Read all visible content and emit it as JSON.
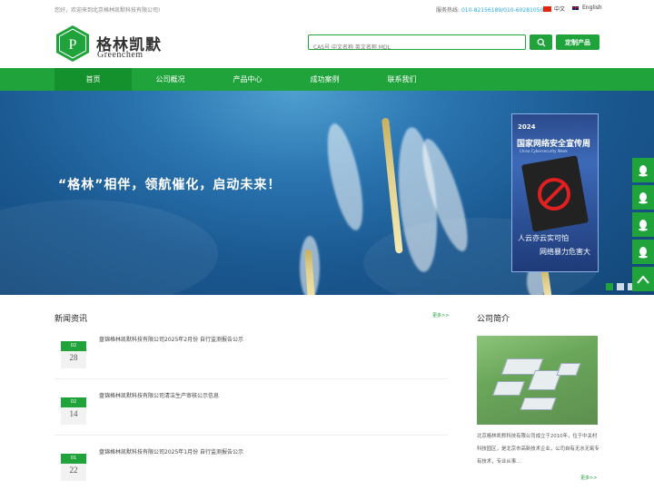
{
  "topbar": {
    "welcome": "您好，欢迎来到北京格林凯默科技有限公司!",
    "hotline_label": "服务热线:",
    "hotline_numbers": "010-82156189/010-60281050",
    "lang_cn": "中文",
    "lang_en": "English"
  },
  "header": {
    "logo_letter": "P",
    "logo_cn": "格林凯默",
    "logo_en": "Greenchem",
    "search_placeholder": "CAS号 中文名称 英文名称 MDL",
    "custom_button": "定制产品"
  },
  "nav": {
    "items": [
      "首页",
      "公司概况",
      "产品中心",
      "成功案例",
      "联系我们"
    ],
    "active": 0
  },
  "banner": {
    "slogan": "“格林”相伴，领航催化，启动未来！",
    "poster": {
      "year": "2024",
      "title": "国家网络安全宣传周",
      "subtitle": "China Cybersecurity Week",
      "line1": "人云亦云实可怕",
      "line2": "网络暴力危害大"
    },
    "slide_count": 4,
    "active_slide": 0
  },
  "news": {
    "title": "新闻资讯",
    "more": "更多>>",
    "items": [
      {
        "month": "02",
        "day": "28",
        "text": "盘锦格林凯默科技有限公司2025年2月份 自行监测报告公示"
      },
      {
        "month": "02",
        "day": "14",
        "text": "盘锦格林凯默科技有限公司清洁生产审核公示信息"
      },
      {
        "month": "01",
        "day": "22",
        "text": "盘锦格林凯默科技有限公司2025年1月份 自行监测报告公示"
      }
    ]
  },
  "about": {
    "title": "公司简介",
    "text": "北京格林凯默科技有限公司成立于2010年，位于中关村科技园区，是北京市高新技术企业，公司自有无水无氧专有技术，专业从事...",
    "more": "更多>>"
  },
  "colors": {
    "brand_green": "#1fa33a",
    "hotline_blue": "#2aa9e0"
  },
  "side_icons": [
    "qq-icon",
    "qq-icon",
    "qq-icon",
    "qq-icon",
    "back-to-top-icon"
  ]
}
